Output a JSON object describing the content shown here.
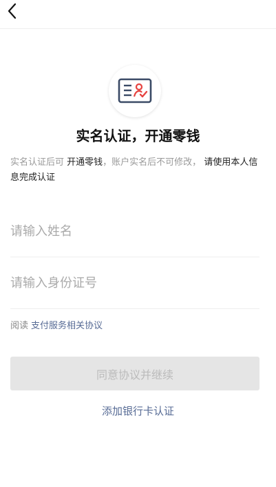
{
  "header": {
    "back_icon": "chevron-left-icon"
  },
  "logo": {
    "icon": "id-card-verified-icon",
    "accent_color": "#e64340",
    "line_color": "#3a4a66"
  },
  "title": "实名认证，开通零钱",
  "description": {
    "part1": "实名认证后可",
    "part2": "开通零钱",
    "part3": "，账户实名后不可修改，",
    "part4": "请使用本人信息完成认证"
  },
  "form": {
    "name_placeholder": "请输入姓名",
    "name_value": "",
    "id_placeholder": "请输入身份证号",
    "id_value": ""
  },
  "agreement": {
    "prefix": "阅读",
    "link_label": "支付服务相关协议"
  },
  "actions": {
    "primary_label": "同意协议并继续",
    "bank_card_label": "添加银行卡认证"
  },
  "colors": {
    "link": "#576b95",
    "button_disabled_bg": "#e5e5e5",
    "button_disabled_text": "#bbbbbb"
  }
}
